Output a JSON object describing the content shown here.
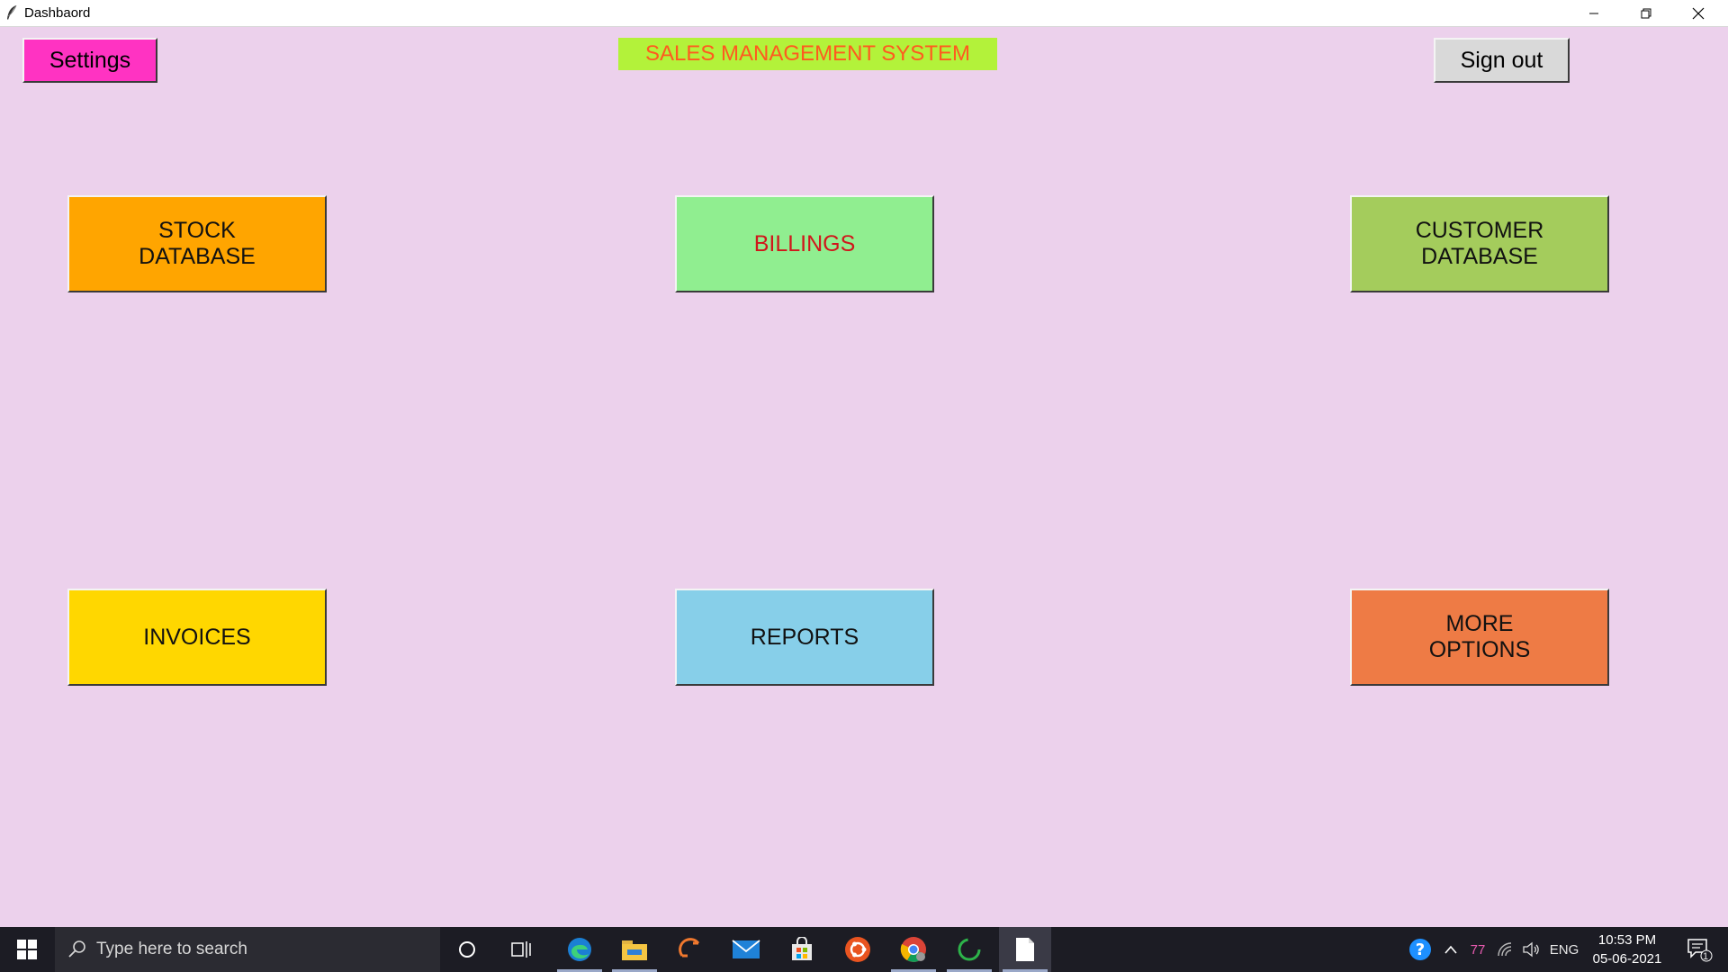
{
  "window": {
    "title": "Dashbaord",
    "controls": [
      "minimize-icon",
      "restore-icon",
      "close-icon"
    ]
  },
  "header": {
    "settings_label": "Settings",
    "app_title": "SALES MANAGEMENT SYSTEM",
    "signout_label": "Sign out"
  },
  "tiles": {
    "stock": "STOCK\nDATABASE",
    "billings": "BILLINGS",
    "customer": "CUSTOMER\nDATABASE",
    "invoices": "INVOICES",
    "reports": "REPORTS",
    "more": "MORE\nOPTIONS"
  },
  "colors": {
    "background": "#ecd1ec",
    "settings": "#ff33c2",
    "title_bg": "#b3f23a",
    "title_text": "#ff5a1f",
    "signout": "#d9d9d9",
    "stock": "#ffa500",
    "billings": "#90ee90",
    "billings_text": "#d0171b",
    "customer": "#a4cc5c",
    "invoices": "#ffd700",
    "reports": "#87cfe9",
    "more": "#ee7b45"
  },
  "taskbar": {
    "search_placeholder": "Type here to search",
    "apps": [
      "cortana-icon",
      "task-view-icon",
      "edge-icon",
      "file-explorer-icon",
      "sublime-icon",
      "mail-icon",
      "store-icon",
      "ubuntu-icon",
      "chrome-icon",
      "loading-app-icon",
      "notepad-icon"
    ],
    "tray": {
      "badge_count": "77",
      "language": "ENG",
      "time": "10:53 PM",
      "date": "05-06-2021",
      "notification_count": "1"
    }
  }
}
